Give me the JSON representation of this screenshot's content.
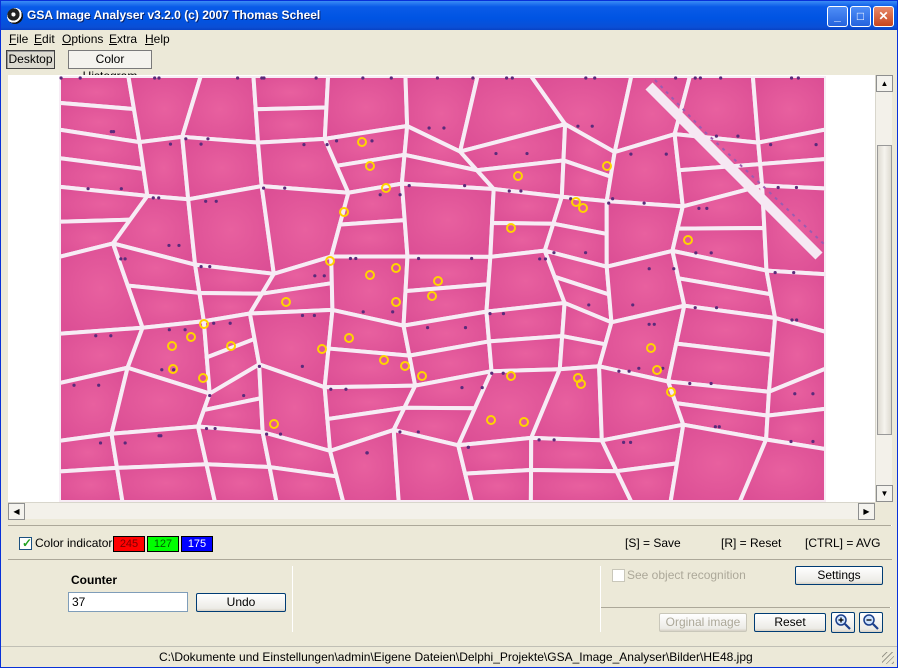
{
  "window": {
    "title": "GSA Image Analyser v3.2.0 (c) 2007   Thomas Scheel"
  },
  "menu": {
    "file": "ile",
    "edit": "dit",
    "options": "ptions",
    "extra": "xtra",
    "help": "elp",
    "file_key": "F",
    "edit_key": "E",
    "options_key": "O",
    "extra_key": "E",
    "help_key": "H"
  },
  "toolbar": {
    "desktop": "Desktop",
    "histogram": "Color Histogram"
  },
  "color_indicator": {
    "label": "Color indicator",
    "checked": true,
    "r": "245",
    "g": "127",
    "b": "175",
    "r_color": "#ff0000",
    "g_color": "#00ff00",
    "b_color": "#0000ff"
  },
  "shortcuts": {
    "save": "[S] = Save",
    "reset": "[R] = Reset",
    "avg": "[CTRL] = AVG"
  },
  "counter": {
    "title": "Counter",
    "value": "37",
    "undo": "Undo"
  },
  "recognition": {
    "label": "See object recognition",
    "checked": false,
    "settings": "Settings"
  },
  "actions": {
    "original": "Orginal image",
    "reset": "Reset"
  },
  "status": {
    "path": "C:\\Dokumente und Einstellungen\\admin\\Eigene Dateien\\Delphi_Projekte\\GSA_Image_Analyser\\Bilder\\HE48.jpg"
  },
  "markers": {
    "count": 37,
    "color": "#ffd400"
  },
  "image_colors": {
    "fiber": "#e35aa2",
    "membrane": "#f5e6f2",
    "nuclei": "#5a2a7a"
  }
}
